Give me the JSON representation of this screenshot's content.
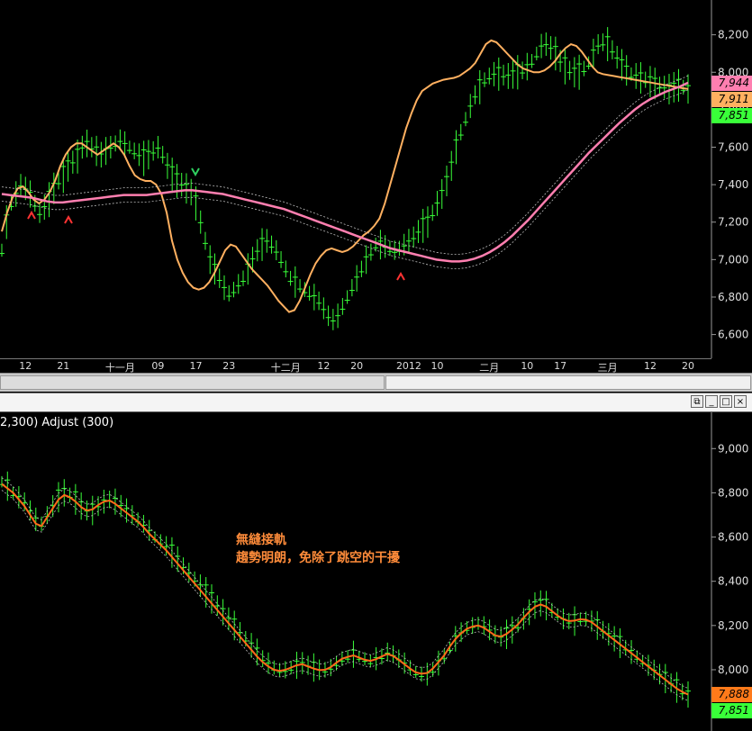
{
  "top_chart": {
    "y_ticks": [
      "8,200",
      "8,000",
      "7,800",
      "7,600",
      "7,400",
      "7,200",
      "7,000",
      "6,800",
      "6,600"
    ],
    "x_labels": [
      {
        "text": "12",
        "i": 5
      },
      {
        "text": "21",
        "i": 13
      },
      {
        "text": "十一月",
        "i": 25
      },
      {
        "text": "09",
        "i": 33
      },
      {
        "text": "17",
        "i": 41
      },
      {
        "text": "23",
        "i": 48
      },
      {
        "text": "十二月",
        "i": 60
      },
      {
        "text": "12",
        "i": 68
      },
      {
        "text": "20",
        "i": 75
      },
      {
        "text": "2012",
        "i": 86
      },
      {
        "text": "10",
        "i": 92
      },
      {
        "text": "二月",
        "i": 103
      },
      {
        "text": "10",
        "i": 111
      },
      {
        "text": "17",
        "i": 118
      },
      {
        "text": "三月",
        "i": 128
      },
      {
        "text": "12",
        "i": 137
      },
      {
        "text": "20",
        "i": 145
      }
    ],
    "badges": [
      {
        "label": "7,944",
        "value": 7944,
        "color": "#ff7fb0"
      },
      {
        "label": "7,911",
        "value": 7911,
        "color": "#ffb060"
      },
      {
        "label": "7,851",
        "value": 7851,
        "color": "#39ff39"
      }
    ]
  },
  "bottom_chart": {
    "indicator_label": "2,300)  Adjust  (300)",
    "y_ticks": [
      "9,000",
      "8,800",
      "8,600",
      "8,400",
      "8,200",
      "8,000"
    ],
    "badges": [
      {
        "label": "7,888",
        "value": 7888,
        "color": "#ff7a1a"
      },
      {
        "label": "7,851",
        "value": 7851,
        "color": "#39ff39"
      }
    ],
    "annotation_line1": "無縫接軌",
    "annotation_line2": "趨勢明朗，免除了跳空的干擾"
  },
  "window_buttons": {
    "restore": "⧉",
    "minimize": "_",
    "maximize": "□",
    "close": "×"
  },
  "chart_data": [
    {
      "type": "line",
      "title": "",
      "ylim": [
        6550,
        8280
      ],
      "series": [
        {
          "key": "price",
          "color": "#39ff39",
          "values": [
            7050,
            7200,
            7300,
            7350,
            7400,
            7380,
            7350,
            7300,
            7250,
            7280,
            7320,
            7380,
            7420,
            7450,
            7500,
            7520,
            7550,
            7600,
            7620,
            7600,
            7580,
            7560,
            7580,
            7600,
            7620,
            7640,
            7620,
            7600,
            7580,
            7560,
            7540,
            7560,
            7580,
            7600,
            7560,
            7500,
            7450,
            7420,
            7400,
            7380,
            7360,
            7300,
            7200,
            7100,
            7000,
            6950,
            6900,
            6850,
            6820,
            6840,
            6870,
            6900,
            6950,
            7000,
            7050,
            7080,
            7100,
            7080,
            7050,
            7000,
            6950,
            6900,
            6880,
            6860,
            6840,
            6820,
            6800,
            6780,
            6740,
            6700,
            6680,
            6700,
            6750,
            6800,
            6850,
            6900,
            6950,
            7000,
            7040,
            7080,
            7080,
            7070,
            7060,
            7050,
            7060,
            7080,
            7100,
            7120,
            7150,
            7180,
            7200,
            7250,
            7300,
            7350,
            7420,
            7500,
            7600,
            7680,
            7750,
            7820,
            7880,
            7920,
            7960,
            7980,
            7990,
            7990,
            7985,
            7980,
            7990,
            8000,
            8010,
            8030,
            8060,
            8100,
            8140,
            8150,
            8130,
            8100,
            8060,
            8030,
            8010,
            8000,
            8000,
            8020,
            8050,
            8100,
            8150,
            8160,
            8150,
            8120,
            8080,
            8040,
            8010,
            7990,
            7980,
            7970,
            7960,
            7950,
            7940,
            7930,
            7920,
            7910,
            7920,
            7930,
            7920,
            7911
          ]
        },
        {
          "key": "fast_ma",
          "color": "#ffb060",
          "values": [
            7150,
            7250,
            7330,
            7380,
            7390,
            7360,
            7320,
            7300,
            7320,
            7360,
            7420,
            7500,
            7560,
            7600,
            7620,
            7620,
            7600,
            7580,
            7560,
            7580,
            7600,
            7620,
            7600,
            7560,
            7500,
            7450,
            7430,
            7420,
            7420,
            7400,
            7350,
            7250,
            7100,
            7000,
            6930,
            6880,
            6850,
            6840,
            6850,
            6880,
            6930,
            6990,
            7050,
            7080,
            7070,
            7030,
            6990,
            6950,
            6920,
            6890,
            6860,
            6820,
            6780,
            6750,
            6720,
            6730,
            6780,
            6850,
            6920,
            6980,
            7020,
            7050,
            7060,
            7050,
            7040,
            7050,
            7070,
            7100,
            7130,
            7150,
            7180,
            7220,
            7300,
            7400,
            7500,
            7600,
            7700,
            7780,
            7850,
            7900,
            7920,
            7940,
            7950,
            7960,
            7965,
            7970,
            7980,
            8000,
            8020,
            8050,
            8100,
            8150,
            8170,
            8160,
            8130,
            8100,
            8070,
            8040,
            8020,
            8010,
            8000,
            8000,
            8010,
            8030,
            8060,
            8100,
            8130,
            8150,
            8140,
            8110,
            8070,
            8030,
            8000,
            7990,
            7985,
            7980,
            7975,
            7970,
            7965,
            7960,
            7955,
            7950,
            7945,
            7940,
            7935,
            7930,
            7925,
            7920,
            7915,
            7911
          ]
        },
        {
          "key": "slow_ma",
          "color": "#ff7fb0",
          "values": [
            7350,
            7345,
            7340,
            7335,
            7330,
            7320,
            7310,
            7305,
            7305,
            7310,
            7315,
            7320,
            7325,
            7330,
            7335,
            7340,
            7345,
            7345,
            7345,
            7345,
            7350,
            7355,
            7360,
            7365,
            7370,
            7370,
            7365,
            7360,
            7355,
            7350,
            7340,
            7330,
            7320,
            7310,
            7300,
            7290,
            7280,
            7270,
            7255,
            7240,
            7225,
            7210,
            7195,
            7180,
            7165,
            7150,
            7135,
            7120,
            7105,
            7090,
            7075,
            7060,
            7050,
            7040,
            7030,
            7020,
            7010,
            7000,
            6995,
            6990,
            6990,
            6995,
            7005,
            7020,
            7040,
            7065,
            7095,
            7130,
            7170,
            7210,
            7255,
            7300,
            7345,
            7390,
            7435,
            7480,
            7525,
            7570,
            7610,
            7650,
            7690,
            7730,
            7765,
            7800,
            7830,
            7855,
            7875,
            7895,
            7910,
            7925,
            7944
          ]
        }
      ]
    },
    {
      "type": "line",
      "title": "",
      "ylim": [
        7780,
        9050
      ],
      "series": [
        {
          "key": "adjusted_price",
          "color": "#39ff39",
          "values": [
            8850,
            8830,
            8800,
            8780,
            8760,
            8720,
            8680,
            8660,
            8700,
            8740,
            8780,
            8800,
            8790,
            8770,
            8740,
            8720,
            8720,
            8740,
            8760,
            8770,
            8760,
            8740,
            8720,
            8700,
            8680,
            8660,
            8630,
            8600,
            8580,
            8560,
            8530,
            8500,
            8470,
            8440,
            8410,
            8380,
            8350,
            8320,
            8290,
            8260,
            8230,
            8200,
            8170,
            8140,
            8110,
            8080,
            8050,
            8030,
            8010,
            8000,
            8000,
            8010,
            8020,
            8030,
            8020,
            8010,
            8000,
            8000,
            8010,
            8030,
            8050,
            8060,
            8070,
            8060,
            8050,
            8040,
            8050,
            8060,
            8080,
            8070,
            8050,
            8030,
            8010,
            7990,
            7980,
            7980,
            8000,
            8030,
            8060,
            8100,
            8140,
            8170,
            8190,
            8200,
            8210,
            8200,
            8180,
            8160,
            8150,
            8160,
            8180,
            8200,
            8230,
            8260,
            8290,
            8300,
            8290,
            8270,
            8250,
            8230,
            8220,
            8220,
            8230,
            8230,
            8220,
            8200,
            8180,
            8160,
            8140,
            8120,
            8100,
            8080,
            8060,
            8040,
            8020,
            8000,
            7980,
            7960,
            7940,
            7920,
            7900,
            7888
          ]
        },
        {
          "key": "adjusted_ma",
          "color": "#ff6a1a",
          "values": [
            8840,
            8820,
            8800,
            8770,
            8740,
            8700,
            8660,
            8650,
            8690,
            8730,
            8770,
            8790,
            8780,
            8760,
            8735,
            8720,
            8725,
            8745,
            8760,
            8765,
            8750,
            8730,
            8710,
            8690,
            8670,
            8645,
            8615,
            8590,
            8565,
            8540,
            8510,
            8480,
            8450,
            8420,
            8390,
            8360,
            8330,
            8300,
            8270,
            8240,
            8210,
            8180,
            8150,
            8120,
            8090,
            8060,
            8035,
            8015,
            8000,
            7995,
            8000,
            8010,
            8020,
            8025,
            8015,
            8005,
            7998,
            8000,
            8012,
            8032,
            8050,
            8058,
            8065,
            8055,
            8045,
            8040,
            8048,
            8060,
            8072,
            8062,
            8045,
            8025,
            8005,
            7988,
            7982,
            7985,
            8005,
            8035,
            8065,
            8105,
            8140,
            8165,
            8185,
            8195,
            8200,
            8190,
            8172,
            8155,
            8150,
            8162,
            8182,
            8205,
            8235,
            8262,
            8285,
            8295,
            8285,
            8265,
            8245,
            8228,
            8220,
            8222,
            8228,
            8226,
            8215,
            8195,
            8175,
            8155,
            8135,
            8115,
            8095,
            8075,
            8055,
            8035,
            8015,
            7995,
            7975,
            7955,
            7935,
            7915,
            7900,
            7888
          ]
        }
      ]
    }
  ]
}
